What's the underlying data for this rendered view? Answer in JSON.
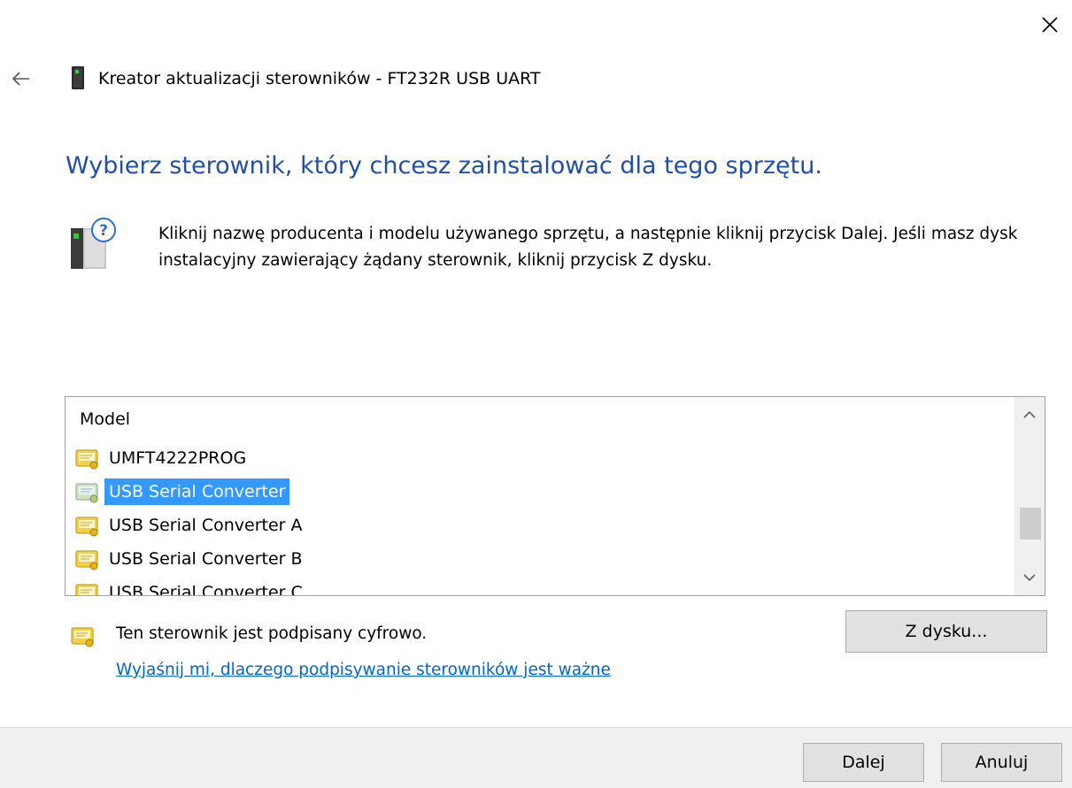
{
  "window": {
    "title": "Kreator aktualizacji sterowników - FT232R USB UART",
    "close_icon": "close-icon",
    "back_icon": "back-arrow-icon"
  },
  "main": {
    "heading": "Wybierz sterownik, który chcesz zainstalować dla tego sprzętu.",
    "instruction": "Kliknij nazwę producenta i modelu używanego sprzętu, a następnie kliknij przycisk Dalej. Jeśli masz dysk instalacyjny zawierający żądany sterownik, kliknij przycisk Z dysku.",
    "accent_color": "#1f4fa8"
  },
  "model_list": {
    "header": "Model",
    "items": [
      {
        "label": "UMFT4222PROG",
        "selected": false
      },
      {
        "label": "USB Serial Converter",
        "selected": true
      },
      {
        "label": "USB Serial Converter A",
        "selected": false
      },
      {
        "label": "USB Serial Converter B",
        "selected": false
      },
      {
        "label": "USB Serial Converter C",
        "selected": false
      }
    ],
    "selection_color": "#3399ff"
  },
  "signature": {
    "text": "Ten sterownik jest podpisany cyfrowo.",
    "link": "Wyjaśnij mi, dlaczego podpisywanie sterowników jest ważne"
  },
  "buttons": {
    "have_disk": "Z dysku...",
    "next": "Dalej",
    "cancel": "Anuluj"
  }
}
